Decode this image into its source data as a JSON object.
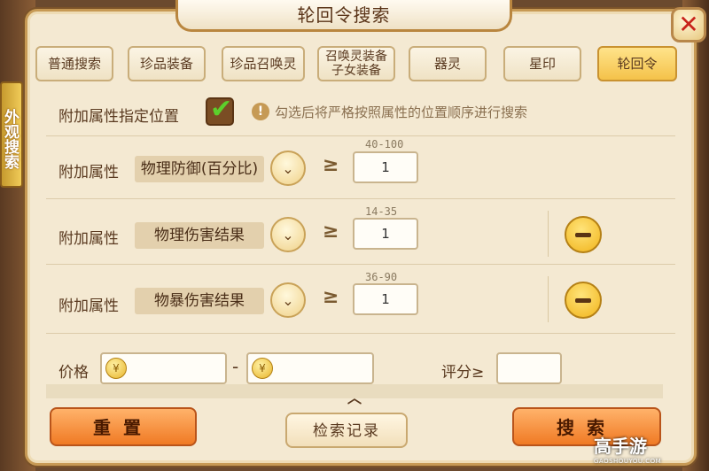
{
  "window": {
    "title": "轮回令搜索"
  },
  "side_tab": {
    "label": "外观搜索"
  },
  "tabs": [
    {
      "label": "普通搜索",
      "active": false
    },
    {
      "label": "珍品装备",
      "active": false
    },
    {
      "label": "珍品召唤灵",
      "active": false
    },
    {
      "label": "召唤灵装备 子女装备",
      "active": false
    },
    {
      "label": "器灵",
      "active": false
    },
    {
      "label": "星印",
      "active": false
    },
    {
      "label": "轮回令",
      "active": true
    }
  ],
  "position_option": {
    "label": "附加属性指定位置",
    "checked": true,
    "hint": "勾选后将严格按照属性的位置顺序进行搜索"
  },
  "attributes": [
    {
      "label": "附加属性",
      "value": "物理防御(百分比)",
      "ge": "≥",
      "range": "40-100",
      "input": "1",
      "removable": false
    },
    {
      "label": "附加属性",
      "value": "物理伤害结果",
      "ge": "≥",
      "range": "14-35",
      "input": "1",
      "removable": true
    },
    {
      "label": "附加属性",
      "value": "物暴伤害结果",
      "ge": "≥",
      "range": "36-90",
      "input": "1",
      "removable": true
    }
  ],
  "price": {
    "label": "价格",
    "dash": "-",
    "min": "",
    "max": ""
  },
  "score": {
    "label": "评分≥",
    "value": ""
  },
  "buttons": {
    "reset": "重置",
    "history": "检索记录",
    "search": "搜索"
  },
  "watermark": {
    "text": "高手游",
    "url": "GAOSHOUYOU.COM"
  },
  "colors": {
    "accent": "#f4c24a",
    "action": "#f07a24",
    "panel": "#f4e9d2"
  }
}
